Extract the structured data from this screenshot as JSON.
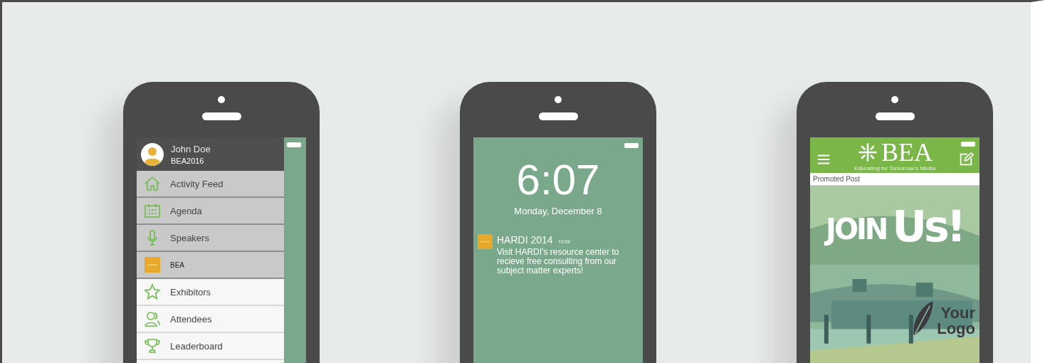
{
  "menu_phone": {
    "user": {
      "name": "John Doe",
      "event": "BEA2016"
    },
    "items": [
      {
        "label": "Activity Feed",
        "shaded": true
      },
      {
        "label": "Agenda",
        "shaded": true
      },
      {
        "label": "Speakers",
        "shaded": true
      },
      {
        "label": "BEA",
        "shaded": true
      },
      {
        "label": "Exhibitors",
        "shaded": false
      },
      {
        "label": "Attendees",
        "shaded": false
      },
      {
        "label": "Leaderboard",
        "shaded": false
      }
    ]
  },
  "lock_phone": {
    "time": "6:07",
    "date": "Monday, December 8",
    "notification": {
      "app": "HARDI 2014",
      "when": "now",
      "message": "Visit HARDI's resource center to recieve free consulting from our subject matter experts!"
    }
  },
  "feed_phone": {
    "brand": "BEA",
    "tagline": "Educating for Tomorrow's Media",
    "section": "Promoted Post",
    "promo": {
      "kind": "picture",
      "headline_1": "JOIN",
      "headline_2": "Us!",
      "logo_line_1": "Your",
      "logo_line_2": "Logo"
    }
  }
}
